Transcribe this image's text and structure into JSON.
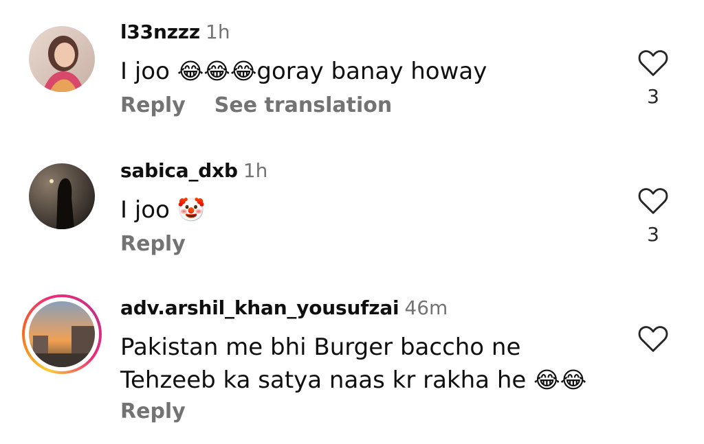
{
  "comments": [
    {
      "username": "l33nzzz",
      "time": "1h",
      "text_before": "I joo ",
      "emojis": "😂😂😂",
      "text_after": "goray banay howay",
      "reply_label": "Reply",
      "translate_label": "See translation",
      "like_count": "3",
      "heart_icon": "heart-outline-icon"
    },
    {
      "username": "sabica_dxb",
      "time": "1h",
      "text_before": "I joo ",
      "emojis": "🤡",
      "reply_label": "Reply",
      "like_count": "3",
      "heart_icon": "heart-outline-icon"
    },
    {
      "username": "adv.arshil_khan_yousufzai",
      "time": "46m",
      "line1": "Pakistan me bhi Burger baccho ne",
      "line2": "Tehzeeb ka satya naas kr rakha he ",
      "emojis": "😂😂",
      "reply_label": "Reply",
      "heart_icon": "heart-outline-icon"
    }
  ],
  "colors": {
    "text": "#0f0f0f",
    "secondary": "#737373",
    "story_ring": [
      "#f9ce34",
      "#ee2a7b",
      "#c13584"
    ]
  }
}
